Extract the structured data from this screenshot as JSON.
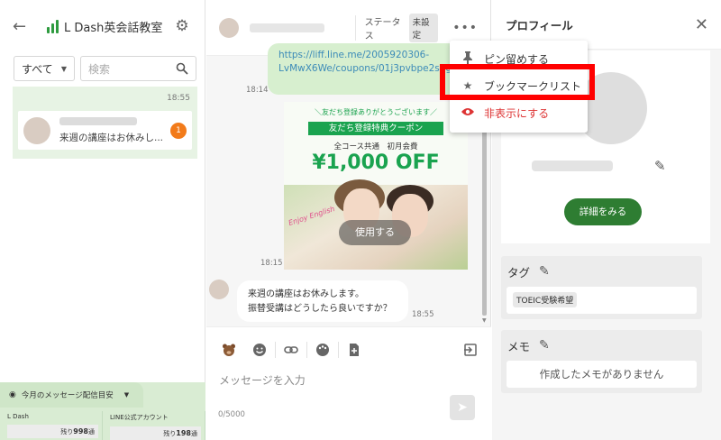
{
  "sidebar": {
    "brand_name": "L Dash英会話教室",
    "filter_label": "すべて",
    "search_placeholder": "検索",
    "list_time": "18:55",
    "conversation_preview": "来週の講座はお休みし...",
    "unread_count": "1"
  },
  "quota": {
    "title": "今月のメッセージ配信目安",
    "col1_label": "L Dash",
    "col1_prefix": "残り",
    "col1_value": "998",
    "col1_unit": "通",
    "col2_label": "LINE公式アカウント",
    "col2_prefix": "残り",
    "col2_value": "198",
    "col2_unit": "通"
  },
  "chat": {
    "status_label": "ステータス",
    "status_value": "未設定",
    "link_text": "https://liff.line.me/2005920306-LvMwX6We/coupons/01j3pvbpe2s2gb54ptw7s57h7",
    "link_time": "18:14",
    "coupon": {
      "top_text": "＼友だち登録ありがとうございます／",
      "ribbon": "友だち登録特典クーポン",
      "subtitle": "全コース共通　初月会費",
      "price": "¥1,000 OFF",
      "enjoy": "Enjoy English",
      "button": "使用する"
    },
    "coupon_time": "18:15",
    "message_line1": "来週の講座はお休みします。",
    "message_line2": "振替受講はどうしたら良いですか？",
    "message_time": "18:55",
    "input_placeholder": "メッセージを入力",
    "counter": "0/5000"
  },
  "menu": {
    "pin": "ピン留めする",
    "bookmark": "ブックマークリスト",
    "hide": "非表示にする"
  },
  "profile": {
    "title": "プロフィール",
    "detail_button": "詳細をみる",
    "tag_label": "タグ",
    "tag_value": "TOEIC受験希望",
    "memo_label": "メモ",
    "memo_empty": "作成したメモがありません"
  },
  "colors": {
    "accent_green": "#2e7d32",
    "selected_bg": "#e7f3e4",
    "badge_orange": "#f27b1a",
    "highlight_red": "#ff0000",
    "danger_red": "#d33333"
  }
}
